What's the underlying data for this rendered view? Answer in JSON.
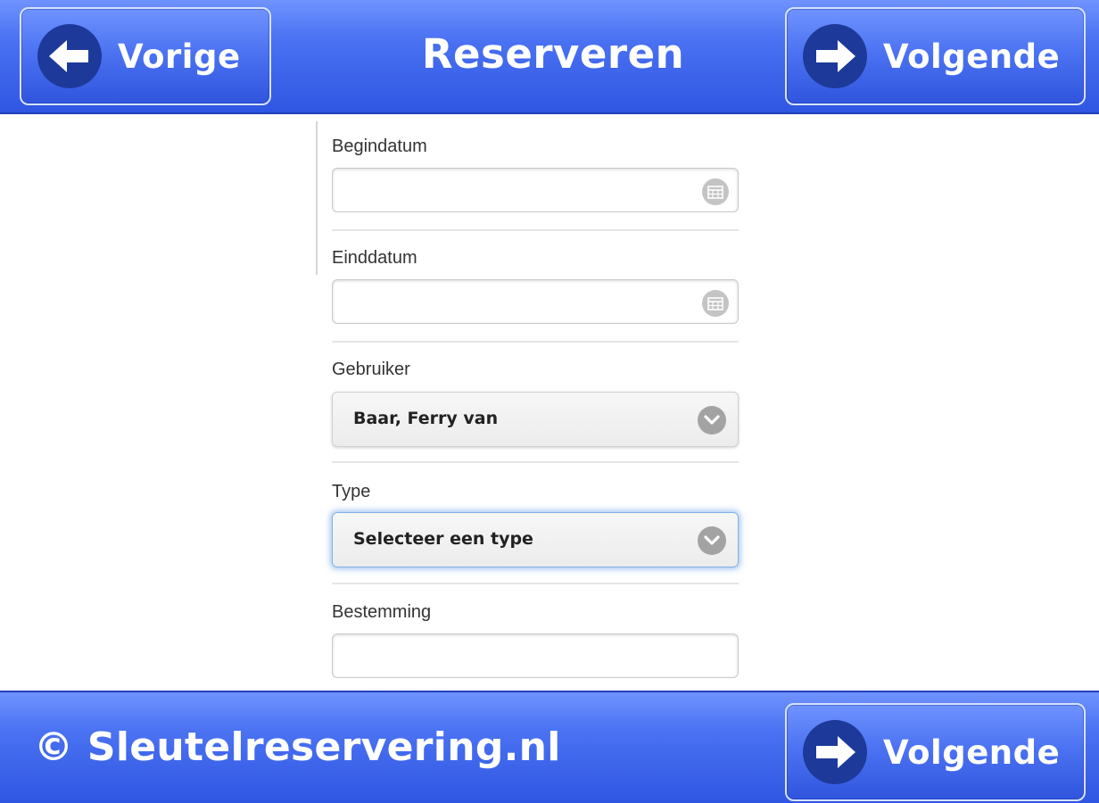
{
  "header": {
    "title": "Reserveren",
    "prev_label": "Vorige",
    "next_label": "Volgende"
  },
  "form": {
    "fields": [
      {
        "label": "Begindatum",
        "value": "",
        "type": "date"
      },
      {
        "label": "Einddatum",
        "value": "",
        "type": "date"
      },
      {
        "label": "Gebruiker",
        "value": "Baar, Ferry van",
        "type": "select"
      },
      {
        "label": "Type",
        "value": "Selecteer een type",
        "type": "select",
        "focused": true
      },
      {
        "label": "Bestemming",
        "value": "",
        "type": "text"
      }
    ]
  },
  "footer": {
    "copyright": "© Sleutelreservering.nl",
    "next_label": "Volgende"
  },
  "colors": {
    "bar_top": "#6f93ff",
    "bar_bottom": "#2f56e2",
    "icon_circle": "#1d3a9a",
    "focus_glow": "#7fb2e6"
  },
  "icons": {
    "prev": "arrow-left-icon",
    "next": "arrow-right-icon",
    "date": "calendar-icon",
    "select": "chevron-down-icon"
  }
}
